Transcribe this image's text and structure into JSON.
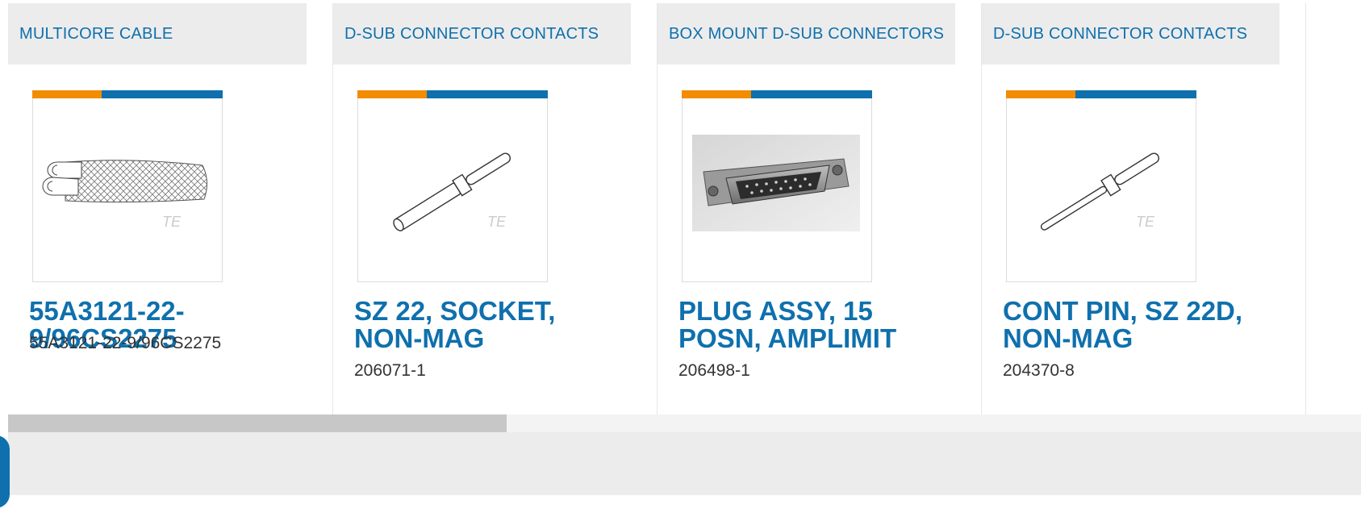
{
  "cards": [
    {
      "category": "MULTICORE CABLE",
      "title": "55A3121-22-9/96CS2275",
      "part_number": "55A3121-22-9/96CS2275",
      "image": "multicore-cable"
    },
    {
      "category": "D-SUB CONNECTOR CONTACTS",
      "title": "SZ 22, SOCKET, NON-MAG",
      "part_number": "206071-1",
      "image": "socket-contact"
    },
    {
      "category": "BOX MOUNT D-SUB CONNECTORS",
      "title": "PLUG ASSY, 15 POSN, AMPLIMIT",
      "part_number": "206498-1",
      "image": "dsub-plug-photo"
    },
    {
      "category": "D-SUB CONNECTOR CONTACTS",
      "title": "CONT PIN, SZ 22D, NON-MAG",
      "part_number": "204370-8",
      "image": "pin-contact"
    }
  ],
  "watermark": "TE",
  "colors": {
    "accent_blue": "#0f70ad",
    "accent_orange": "#f28c00",
    "header_bg": "#ececec"
  },
  "scroll_position_fraction": 0.37
}
